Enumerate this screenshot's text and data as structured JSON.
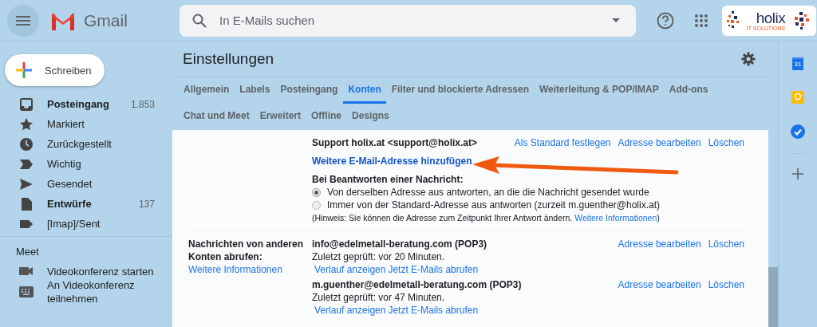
{
  "topbar": {
    "app_name": "Gmail",
    "search": {
      "placeholder": "In E-Mails suchen"
    },
    "logo": {
      "name": "holix",
      "tagline": "IT SOLUTIONS"
    }
  },
  "compose_button": "Schreiben",
  "sidebar": {
    "items": [
      {
        "label": "Posteingang",
        "count": "1.853",
        "bold": true,
        "kind": "inbox"
      },
      {
        "label": "Markiert",
        "bold": false,
        "kind": "star"
      },
      {
        "label": "Zurückgestellt",
        "bold": false,
        "kind": "clock"
      },
      {
        "label": "Wichtig",
        "bold": false,
        "kind": "label"
      },
      {
        "label": "Gesendet",
        "bold": false,
        "kind": "send"
      },
      {
        "label": "Entwürfe",
        "count": "137",
        "bold": true,
        "kind": "file"
      },
      {
        "label": "[Imap]/Sent",
        "bold": false,
        "kind": "folder"
      }
    ],
    "meet": {
      "heading": "Meet",
      "items": [
        {
          "label": "Videokonferenz starten",
          "kind": "video"
        },
        {
          "label": "An Videokonferenz teilnehmen",
          "kind": "keyboard"
        }
      ]
    }
  },
  "settings": {
    "title": "Einstellungen",
    "tab_rows": [
      [
        {
          "label": "Allgemein",
          "selected": false
        },
        {
          "label": "Labels",
          "selected": false
        },
        {
          "label": "Posteingang",
          "selected": false
        },
        {
          "label": "Konten",
          "selected": true
        },
        {
          "label": "Filter und blockierte Adressen",
          "selected": false
        },
        {
          "label": "Weiterleitung & POP/IMAP",
          "selected": false
        },
        {
          "label": "Add-ons",
          "selected": false
        }
      ],
      [
        {
          "label": "Chat und Meet",
          "selected": false
        },
        {
          "label": "Erweitert",
          "selected": false
        },
        {
          "label": "Offline",
          "selected": false
        },
        {
          "label": "Designs",
          "selected": false
        }
      ]
    ],
    "send_as": {
      "account": "Support holix.at <support@holix.at>",
      "actions": [
        "Als Standard festlegen",
        "Adresse bearbeiten",
        "Löschen"
      ],
      "add_link": "Weitere E-Mail-Adresse hinzufügen"
    },
    "reply": {
      "heading": "Bei Beantworten einer Nachricht:",
      "options": [
        {
          "label": "Von derselben Adresse aus antworten, an die die Nachricht gesendet wurde",
          "selected": true
        },
        {
          "label": "Immer von der Standard-Adresse aus antworten (zurzeit m.guenther@holix.at)",
          "selected": false
        }
      ],
      "hint": {
        "text": "(Hinweis: Sie können die Adresse zum Zeitpunkt Ihrer Antwort ändern.",
        "link": "Weitere Informationen",
        "close": ")"
      }
    },
    "check_mail": {
      "label": "Nachrichten von anderen Konten abrufen:",
      "link": "Weitere Informationen",
      "accounts": [
        {
          "address": "info@edelmetall-beratung.com (POP3)",
          "status": "Zuletzt geprüft: vor 20 Minuten.",
          "links": [
            "Verlauf anzeigen",
            "Jetzt E-Mails abrufen"
          ],
          "actions": [
            "Adresse bearbeiten",
            "Löschen"
          ]
        },
        {
          "address": "m.guenther@edelmetall-beratung.com (POP3)",
          "status": "Zuletzt geprüft: vor 47 Minuten.",
          "links": [
            "Verlauf anzeigen",
            "Jetzt E-Mails abrufen"
          ],
          "actions": [
            "Adresse bearbeiten",
            "Löschen"
          ]
        }
      ]
    }
  },
  "right_rail": {
    "calendar_day": "31"
  }
}
